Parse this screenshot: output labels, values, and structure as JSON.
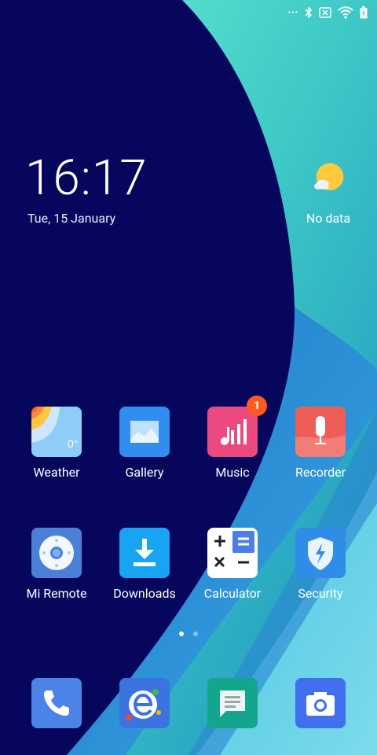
{
  "status_bar": {
    "more_dots": "•••"
  },
  "clock": {
    "time": "16:17",
    "date": "Tue, 15 January"
  },
  "weather_widget": {
    "label": "No data"
  },
  "apps_row1": [
    {
      "label": "Weather",
      "temp_text": "0°"
    },
    {
      "label": "Gallery"
    },
    {
      "label": "Music",
      "badge": "1"
    },
    {
      "label": "Recorder"
    }
  ],
  "apps_row2": [
    {
      "label": "Mi Remote"
    },
    {
      "label": "Downloads"
    },
    {
      "label": "Calculator"
    },
    {
      "label": "Security"
    }
  ],
  "dock": [
    {
      "name": "Phone"
    },
    {
      "name": "Browser"
    },
    {
      "name": "Messaging"
    },
    {
      "name": "Camera"
    }
  ],
  "colors": {
    "background_dark": "#06065c",
    "background_teal": "#4fd9c9",
    "accent": "#ff5a1f"
  }
}
